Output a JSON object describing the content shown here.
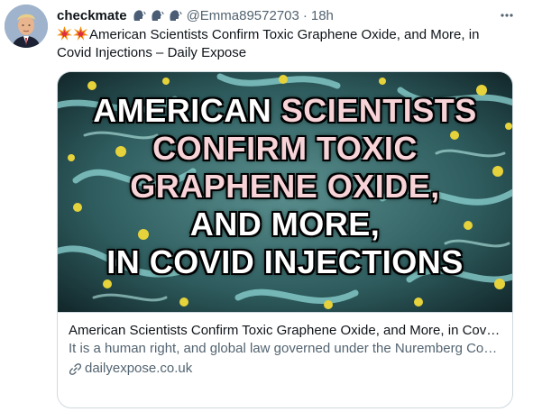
{
  "tweet": {
    "display_name": "checkmate",
    "badge_icons": [
      "speaking-head-icon",
      "speaking-head-icon",
      "speaking-head-icon"
    ],
    "handle": "@Emma89572703",
    "separator": "·",
    "time": "18h",
    "text_icons": [
      "collision-icon",
      "collision-icon"
    ],
    "text": "American Scientists Confirm Toxic Graphene Oxide, and More, in Covid Injections – Daily Expose",
    "more_icon": "more-horizontal-icon"
  },
  "card": {
    "image_headline": {
      "line1_white": "AMERICAN",
      "line1_pink": "SCIENTISTS",
      "line2": "CONFIRM TOXIC",
      "line3": "GRAPHENE OXIDE,",
      "line4": "AND MORE,",
      "line5": "IN COVID INJECTIONS"
    },
    "title": "American Scientists Confirm Toxic Graphene Oxide, and More, in Covid Injections – Daily Expose",
    "description": "It is a human right, and global law governed under the Nuremberg Code, that vaccine specific ingredient information is disclosed.  It is critical, and foundational to informed consent.",
    "domain": "dailyexpose.co.uk",
    "domain_icon": "link-icon"
  },
  "colors": {
    "text_primary": "#0f1419",
    "text_secondary": "#536471",
    "border": "#cfd9de",
    "headline_pink": "#f7d3d8"
  }
}
